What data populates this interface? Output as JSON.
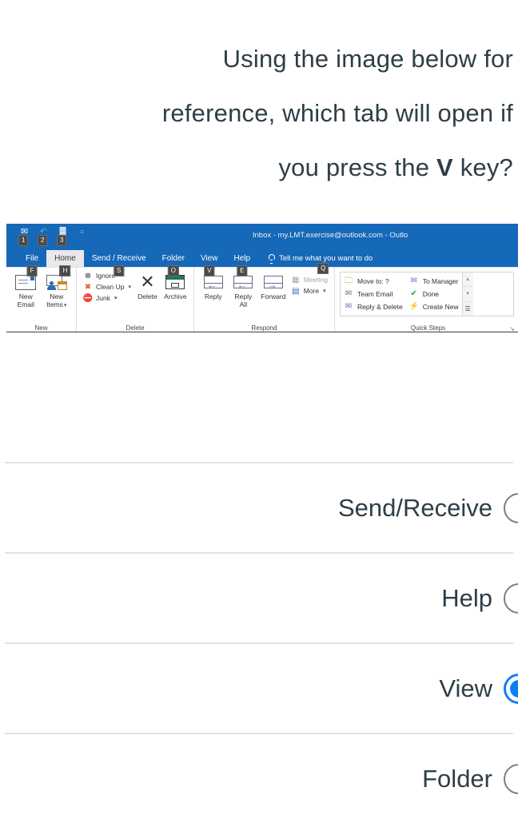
{
  "question": {
    "line1": "Using the image below for",
    "line2": "reference, which tab will open if",
    "line3_prefix": "?you press the ",
    "line3_key": "V",
    "line3_suffix": " key",
    "text_color": "#2f3e46"
  },
  "outlook": {
    "titlebar": {
      "title": "Inbox - my.LMT.exercise@outlook.com  -  Outlo",
      "background": "#1668b8",
      "quick_access": [
        {
          "icon": "save-send-icon",
          "glyph": "✉",
          "keytip": "1"
        },
        {
          "icon": "undo-icon",
          "glyph": "↶",
          "keytip": "2"
        },
        {
          "icon": "grid-icon",
          "glyph": "▓",
          "keytip": "3"
        },
        {
          "icon": "customize-qat-icon",
          "glyph": "≡",
          "keytip": ""
        }
      ]
    },
    "tabs": [
      {
        "label": "File",
        "keytip": "F",
        "active": false
      },
      {
        "label": "Home",
        "keytip": "H",
        "active": true
      },
      {
        "label": "Send / Receive",
        "keytip": "S",
        "active": false
      },
      {
        "label": "Folder",
        "keytip": "O",
        "active": false
      },
      {
        "label": "View",
        "keytip": "V",
        "active": false
      },
      {
        "label": "Help",
        "keytip": "E",
        "active": false
      }
    ],
    "tell_me": {
      "label": "Tell me what you want to do",
      "keytip": "Q"
    },
    "groups": [
      {
        "name": "New",
        "big_buttons": [
          {
            "label_line1": "New",
            "label_line2": "Email",
            "icon": "new-email-icon"
          },
          {
            "label_line1": "New",
            "label_line2": "Items",
            "icon": "new-items-icon",
            "caret": "▾"
          }
        ],
        "small_buttons": []
      },
      {
        "name": "Delete",
        "small_buttons": [
          {
            "label": "Ignore",
            "icon": "ignore-icon",
            "glyph": "⊗",
            "caret": ""
          },
          {
            "label": "Clean Up",
            "icon": "clean-up-icon",
            "glyph": "✖",
            "caret": "▾"
          },
          {
            "label": "Junk",
            "icon": "junk-icon",
            "glyph": "⛔",
            "caret": "▾"
          }
        ],
        "big_buttons": [
          {
            "label_line1": "Delete",
            "label_line2": "",
            "icon": "delete-x-icon"
          },
          {
            "label_line1": "Archive",
            "label_line2": "",
            "icon": "archive-icon"
          }
        ]
      },
      {
        "name": "Respond",
        "big_buttons": [
          {
            "label_line1": "Reply",
            "label_line2": "",
            "icon": "reply-icon"
          },
          {
            "label_line1": "Reply",
            "label_line2": "All",
            "icon": "reply-all-icon"
          },
          {
            "label_line1": "Forward",
            "label_line2": "",
            "icon": "forward-icon"
          }
        ],
        "small_buttons": [
          {
            "label": "Meeting",
            "icon": "meeting-icon",
            "glyph": "▦",
            "disabled": true
          },
          {
            "label": "More",
            "icon": "more-icon",
            "glyph": "▤",
            "caret": "▾"
          }
        ]
      },
      {
        "name": "Quick Steps",
        "gallery_col1": [
          {
            "label": "Move to: ?",
            "icon": "folder-move-icon",
            "glyph": "🗀"
          },
          {
            "label": "Team Email",
            "icon": "team-email-icon",
            "glyph": "✉"
          },
          {
            "label": "Reply & Delete",
            "icon": "reply-delete-icon",
            "glyph": "✉"
          }
        ],
        "gallery_col2": [
          {
            "label": "To Manager",
            "icon": "to-manager-icon",
            "glyph": "✉"
          },
          {
            "label": "Done",
            "icon": "done-check-icon",
            "glyph": "✔"
          },
          {
            "label": "Create New",
            "icon": "create-new-icon",
            "glyph": "⚡"
          }
        ],
        "scroll": {
          "up": "▲",
          "down": "▼",
          "more": "☰"
        },
        "launcher": "↘"
      }
    ]
  },
  "answers": {
    "selected_index": 2,
    "options": [
      {
        "label": "Send/Receive",
        "selected": false
      },
      {
        "label": "Help",
        "selected": false
      },
      {
        "label": "View",
        "selected": true
      },
      {
        "label": "Folder",
        "selected": false
      }
    ],
    "accent_color": "#0d7ff2",
    "unselected_border": "#7d7d7d"
  }
}
